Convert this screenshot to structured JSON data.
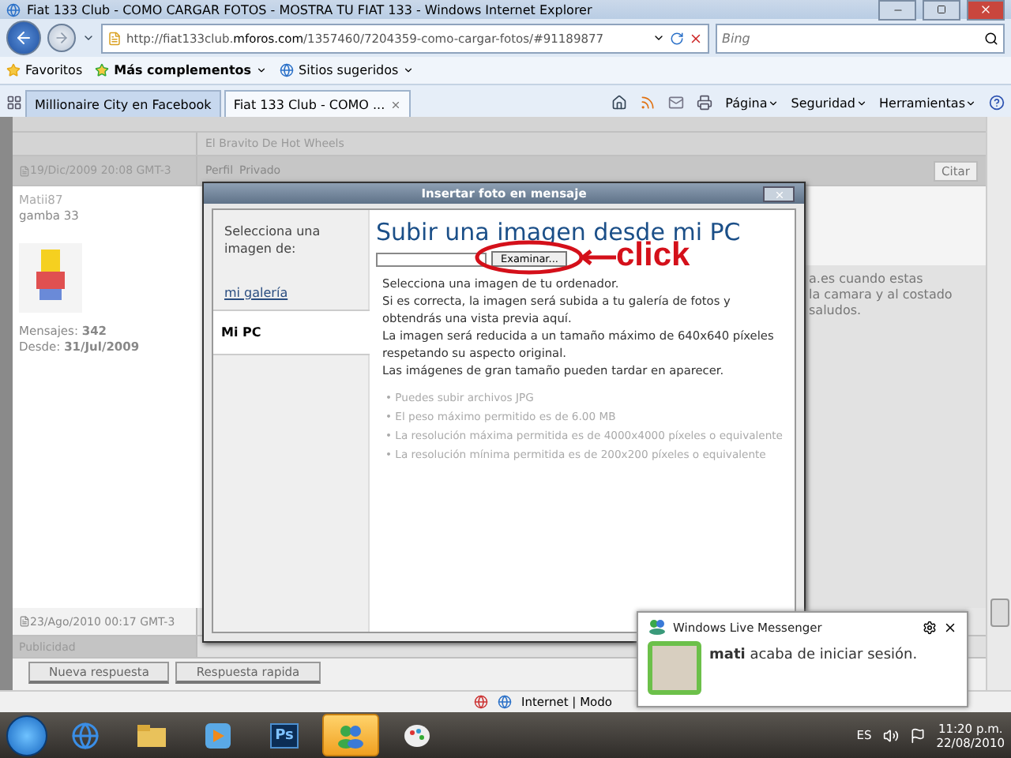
{
  "window": {
    "title": "Fiat 133 Club - COMO CARGAR FOTOS - MOSTRA TU FIAT 133 - Windows Internet Explorer"
  },
  "address_bar": {
    "url": "http://fiat133club.**mforos.com**/1357460/7204359-como-cargar-fotos/#91189877"
  },
  "search": {
    "placeholder": "Bing"
  },
  "favorites_bar": {
    "favorites": "Favoritos",
    "addons": "Más complementos",
    "suggested": "Sitios sugeridos"
  },
  "tabs": [
    {
      "label": "Millionaire City en Facebook",
      "selected": false
    },
    {
      "label": "Fiat 133 Club - COMO ...",
      "selected": true
    }
  ],
  "command_bar": {
    "menus": [
      "Página",
      "Seguridad",
      "Herramientas"
    ]
  },
  "forum": {
    "signature": "El Bravito De Hot Wheels",
    "post": {
      "date": "19/Dic/2009 20:08 GMT-3",
      "links": [
        "Perfil",
        "Privado"
      ],
      "quote_button": "Citar",
      "author": "Matii87",
      "rank": "gamba 33",
      "messages": "Mensajes: **342**",
      "since": "Desde: **31/Jul/2009**",
      "body_lines": [
        "a.es cuando estas",
        "la camara y al costado",
        "saludos."
      ]
    },
    "next_post_date": "23/Ago/2010 00:17 GMT-3",
    "ad_label": "Publicidad",
    "buttons": [
      "Nueva respuesta",
      "Respuesta rapida"
    ]
  },
  "dialog": {
    "title": "Insertar foto en mensaje",
    "sidebar_heading": "Selecciona una imagen de:",
    "sources": [
      {
        "label": "mi galería",
        "selected": false
      },
      {
        "label": "Mi PC",
        "selected": true
      }
    ],
    "heading": "Subir una imagen desde mi PC",
    "browse_button": "Examinar...",
    "lines": [
      "Selecciona una imagen de tu ordenador.",
      "Si es correcta, la imagen será subida a tu galería de fotos y",
      "obtendrás una vista previa aquí.",
      "La imagen será reducida a un tamaño máximo de 640x640 píxeles",
      "respetando su aspecto original.",
      "Las imágenes de gran tamaño pueden tardar en aparecer."
    ],
    "notes": [
      "• Puedes subir archivos JPG",
      "• El peso máximo permitido es de 6.00 MB",
      "• La resolución máxima permitida es de 4000x4000 píxeles o equivalente",
      "• La resolución mínima permitida es de 200x200 píxeles o equivalente"
    ]
  },
  "annotation": {
    "text": "click"
  },
  "status_bar": {
    "zone": "Internet | Modo"
  },
  "messenger": {
    "title": "Windows Live Messenger",
    "message": "**mati** acaba de iniciar sesión."
  },
  "taskbar": {
    "apps": [
      {
        "kind": "browser",
        "selected": false
      },
      {
        "kind": "folder",
        "selected": false
      },
      {
        "kind": "media",
        "selected": false
      },
      {
        "kind": "photoshop",
        "label": "Ps",
        "selected": false
      },
      {
        "kind": "messenger",
        "selected": true
      },
      {
        "kind": "paint",
        "selected": false
      }
    ],
    "language": "ES",
    "time": "11:20 p.m.",
    "date": "22/08/2010"
  }
}
